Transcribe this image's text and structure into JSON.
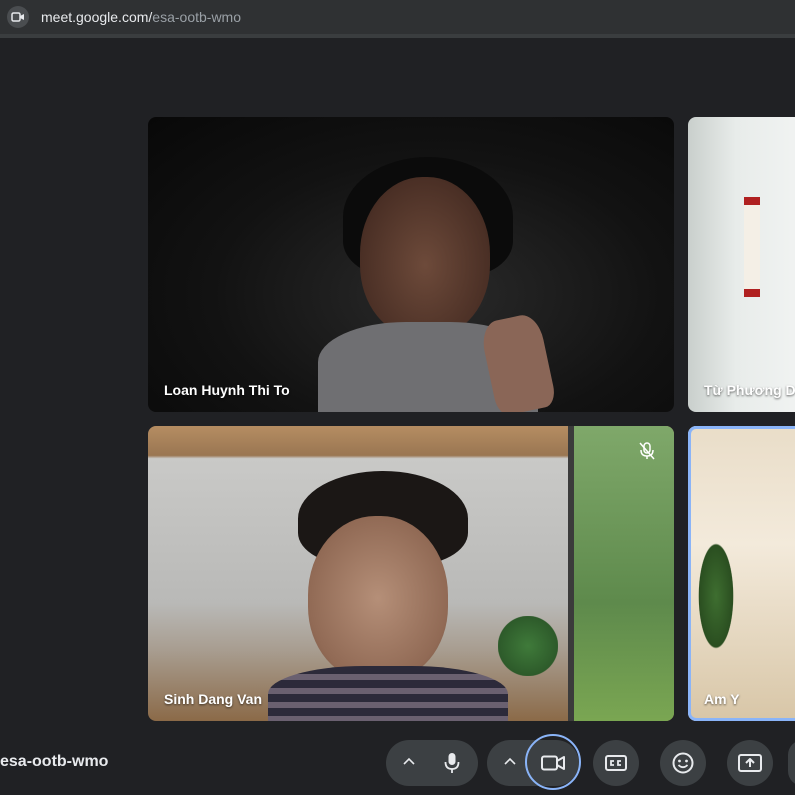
{
  "browser": {
    "url_host": "meet.google.com/",
    "url_path": "esa-ootb-wmo"
  },
  "tiles": [
    {
      "name": "Loan Huynh Thi To"
    },
    {
      "name": "Từ Phương D"
    },
    {
      "name": "Sinh Dang Van",
      "muted": true
    },
    {
      "name": "Am Y",
      "active_speaker": true
    }
  ],
  "bottom_bar": {
    "meeting_code": "esa-ootb-wmo"
  },
  "controls": [
    {
      "id": "mic-options",
      "icon": "chevron-up-icon"
    },
    {
      "id": "microphone",
      "icon": "microphone-icon"
    },
    {
      "id": "camera-options",
      "icon": "chevron-up-icon"
    },
    {
      "id": "camera",
      "icon": "videocam-icon",
      "focused": true
    },
    {
      "id": "captions",
      "icon": "closed-captions-icon"
    },
    {
      "id": "reactions",
      "icon": "emoji-icon"
    },
    {
      "id": "present",
      "icon": "present-screen-icon"
    }
  ],
  "colors": {
    "background": "#202124",
    "control_bg": "#3c4043",
    "focus_ring": "#8ab4f8"
  }
}
